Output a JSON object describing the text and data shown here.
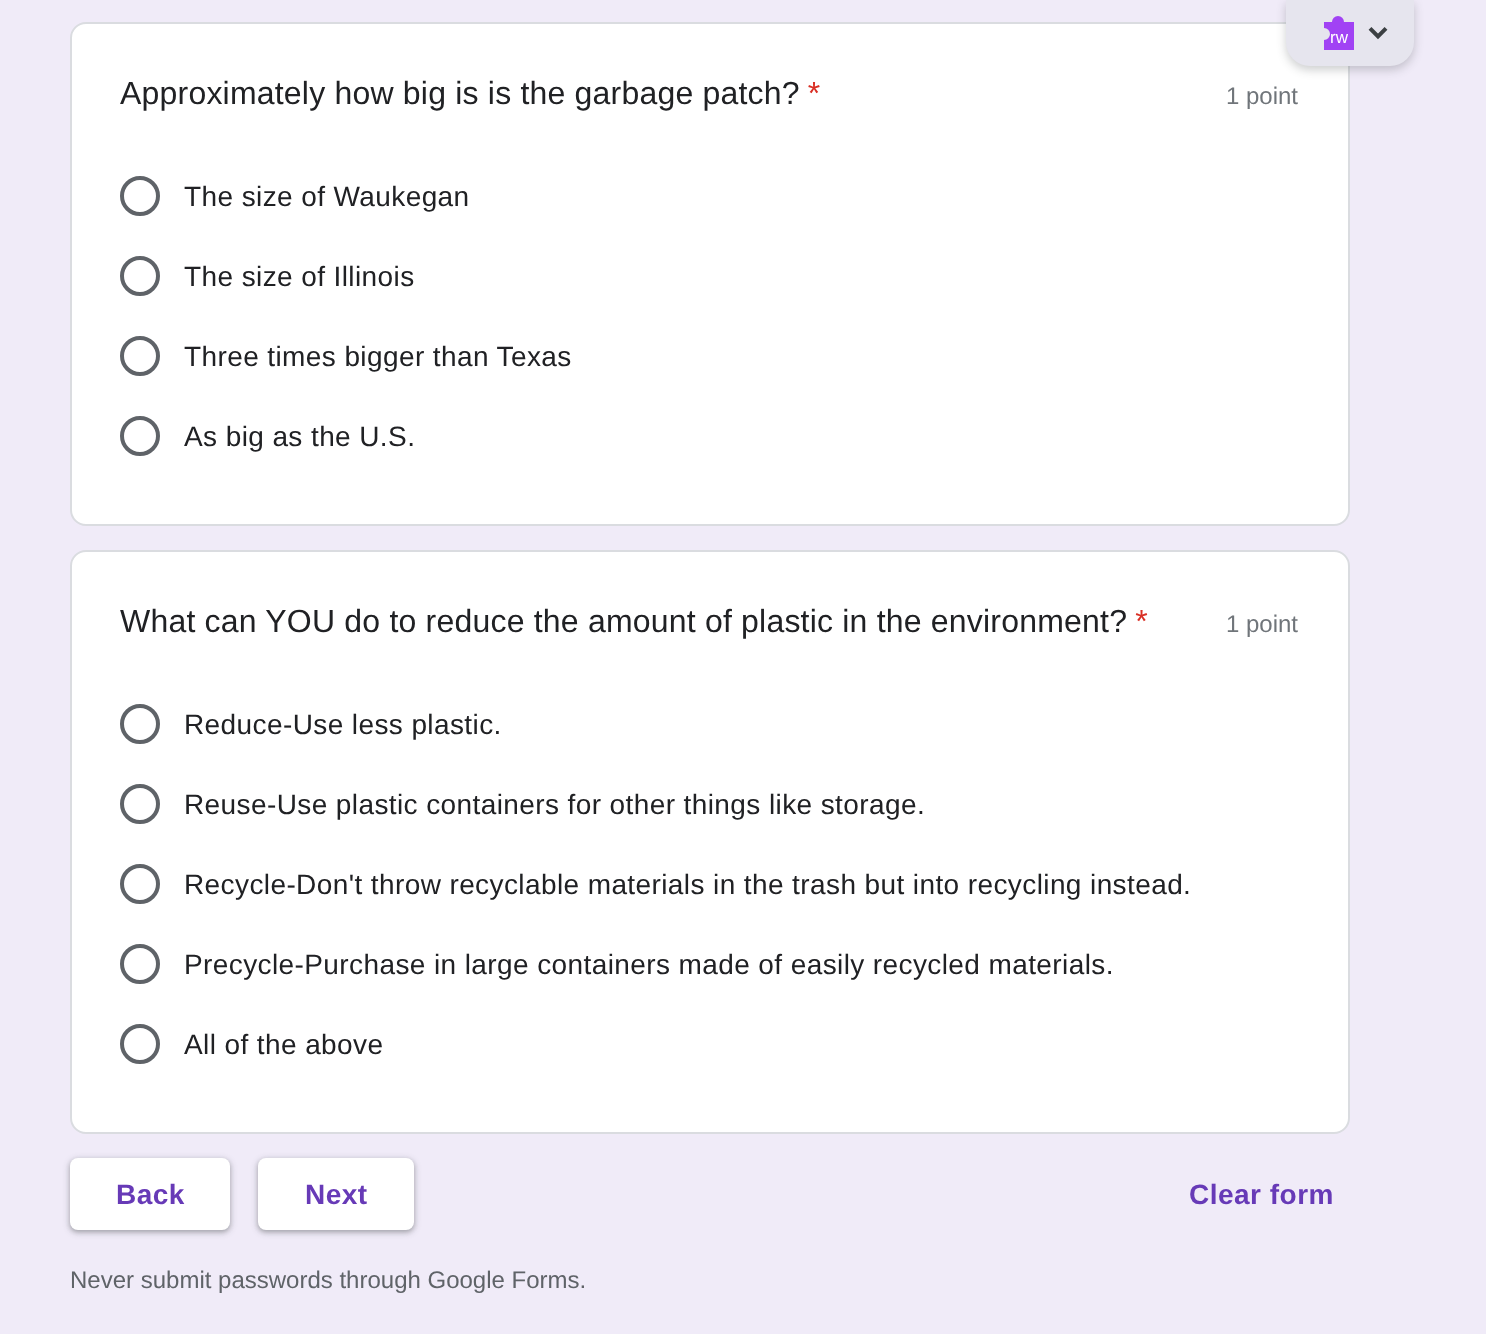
{
  "extension": {
    "logo_text": "rw"
  },
  "questions": [
    {
      "title": "Approximately how big is is the garbage patch?",
      "required_mark": "*",
      "points": "1 point",
      "options": [
        {
          "label": "The size of Waukegan",
          "selected": false
        },
        {
          "label": "The size of Illinois",
          "selected": false
        },
        {
          "label": "Three times bigger than Texas",
          "selected": false
        },
        {
          "label": "As big as the U.S.",
          "selected": false
        }
      ]
    },
    {
      "title": "What can YOU do to reduce the amount of plastic in the environment?",
      "required_mark": "*",
      "points": "1 point",
      "options": [
        {
          "label": "Reduce-Use less plastic.",
          "selected": false
        },
        {
          "label": "Reuse-Use plastic containers for other things like storage.",
          "selected": false
        },
        {
          "label": "Recycle-Don't throw recyclable materials in the trash but into recycling instead.",
          "selected": false
        },
        {
          "label": "Precycle-Purchase in large containers made of easily recycled materials.",
          "selected": false
        },
        {
          "label": "All of the above",
          "selected": false
        }
      ]
    }
  ],
  "navigation": {
    "buttons": [
      "Back",
      "Next"
    ],
    "clear": "Clear form"
  },
  "footer": "Never submit passwords through Google Forms."
}
